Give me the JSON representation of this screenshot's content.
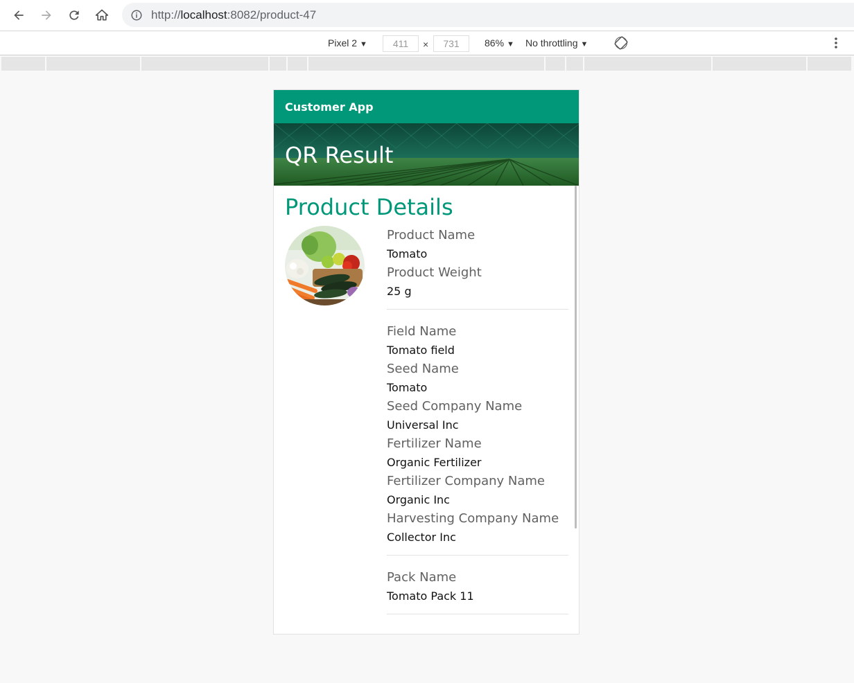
{
  "browser": {
    "url_scheme_prefix": "http://",
    "url_host": "localhost",
    "url_rest": ":8082/product-47"
  },
  "device_toolbar": {
    "device": "Pixel 2",
    "width": "411",
    "times": "×",
    "height": "731",
    "zoom": "86%",
    "throttling": "No throttling"
  },
  "app": {
    "toolbar_title": "Customer App",
    "banner_title": "QR Result",
    "section_title": "Product Details"
  },
  "product": {
    "groups": [
      [
        {
          "label": "Product Name",
          "value": "Tomato"
        },
        {
          "label": "Product Weight",
          "value": "25 g"
        }
      ],
      [
        {
          "label": "Field Name",
          "value": "Tomato field"
        },
        {
          "label": "Seed Name",
          "value": "Tomato"
        },
        {
          "label": "Seed Company Name",
          "value": "Universal Inc"
        },
        {
          "label": "Fertilizer Name",
          "value": "Organic Fertilizer"
        },
        {
          "label": "Fertilizer Company Name",
          "value": "Organic Inc"
        },
        {
          "label": "Harvesting Company Name",
          "value": "Collector Inc"
        }
      ],
      [
        {
          "label": "Pack Name",
          "value": "Tomato Pack 11"
        }
      ]
    ]
  },
  "icons": {
    "back": "arrow-left-icon",
    "forward": "arrow-right-icon",
    "reload": "reload-icon",
    "home": "home-icon",
    "info": "info-icon",
    "rotate": "rotate-icon",
    "menu": "more-vert-icon"
  },
  "colors": {
    "accent": "#009879"
  }
}
